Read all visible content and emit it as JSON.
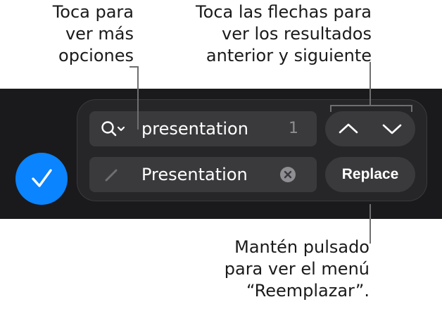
{
  "callouts": {
    "more_options": "Toca para\nver más\nopciones",
    "arrows": "Toca las flechas para\nver los resultados\nanterior y siguiente",
    "replace_hold": "Mantén pulsado\npara ver el menú\n“Reemplazar”."
  },
  "find": {
    "value": "presentation",
    "match_count": "1",
    "icon": "search-options-icon"
  },
  "replace": {
    "value": "Presentation",
    "button_label": "Replace",
    "icon": "pencil-icon",
    "clear_icon": "clear-icon"
  },
  "navigation": {
    "previous_icon": "chevron-up-icon",
    "next_icon": "chevron-down-icon"
  },
  "done_icon": "checkmark-icon",
  "colors": {
    "accent": "#0a84ff",
    "toolbar_background": "#1a1a1c",
    "field_background": "#3a3a3c",
    "panel_background": "#262628"
  }
}
